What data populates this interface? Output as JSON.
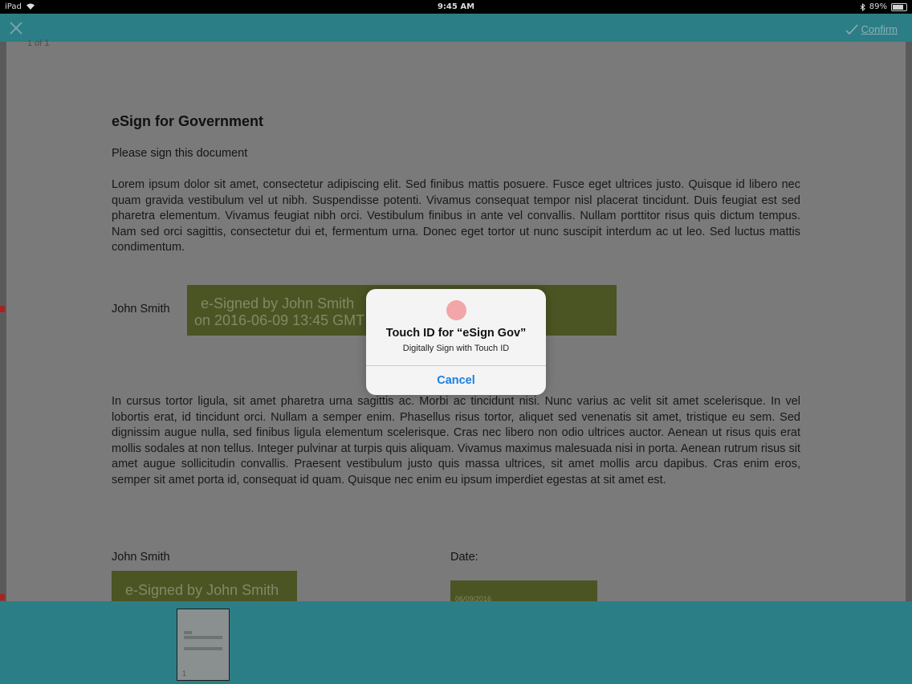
{
  "status_bar": {
    "device": "iPad",
    "time": "9:45 AM",
    "battery": "89%",
    "battery_level": 0.89
  },
  "toolbar": {
    "confirm_label": "Confirm"
  },
  "document": {
    "page_indicator": "1 of 1",
    "title": "eSign for Government",
    "subtitle": "Please sign this document",
    "paragraph1": "Lorem ipsum dolor sit amet, consectetur adipiscing elit. Sed finibus mattis posuere. Fusce eget ultrices justo. Quisque id libero nec quam gravida vestibulum vel ut nibh. Suspendisse potenti. Vivamus consequat tempor nisl placerat tincidunt. Duis feugiat est sed pharetra elementum. Vivamus feugiat nibh orci. Vestibulum finibus in ante vel convallis. Nullam porttitor risus quis dictum tempus. Nam sed orci sagittis, consectetur dui et, fermentum urna. Donec eget tortor ut nunc suscipit interdum ac ut leo. Sed luctus mattis condimentum.",
    "signer_name_1": "John Smith",
    "signature_1": {
      "line1": "e-Signed by John Smith",
      "line2": "on 2016-06-09 13:45 GMT"
    },
    "paragraph2": "In cursus tortor ligula, sit amet pharetra urna sagittis ac. Morbi ac tincidunt nisi. Nunc varius ac velit sit amet scelerisque. In vel lobortis erat, id tincidunt orci. Nullam a semper enim. Phasellus risus tortor, aliquet sed venenatis sit amet, tristique eu sem. Sed dignissim augue nulla, sed finibus ligula elementum scelerisque. Cras nec libero non odio ultrices auctor. Aenean ut risus quis erat mollis sodales at non tellus. Integer pulvinar at turpis quis aliquam. Vivamus maximus malesuada nisi in porta. Aenean rutrum risus sit amet augue sollicitudin convallis. Praesent vestibulum justo quis massa ultrices, sit amet mollis arcu dapibus. Cras enim eros, semper sit amet porta id, consequat id quam. Quisque nec enim eu ipsum imperdiet egestas at sit amet est.",
    "signer_name_2": "John Smith",
    "signature_2": {
      "line1": "e-Signed by John Smith"
    },
    "date_label": "Date:",
    "date_value": "06/09/2016"
  },
  "thumbnail": {
    "page_number": "1"
  },
  "alert": {
    "title": "Touch ID for “eSign Gov”",
    "message": "Digitally Sign with Touch ID",
    "cancel_label": "Cancel"
  },
  "colors": {
    "toolbar": "#2c7e86",
    "signature_box": "#4b5423",
    "alert_button": "#1a7fe5",
    "touch_icon": "#f2a6a8"
  }
}
